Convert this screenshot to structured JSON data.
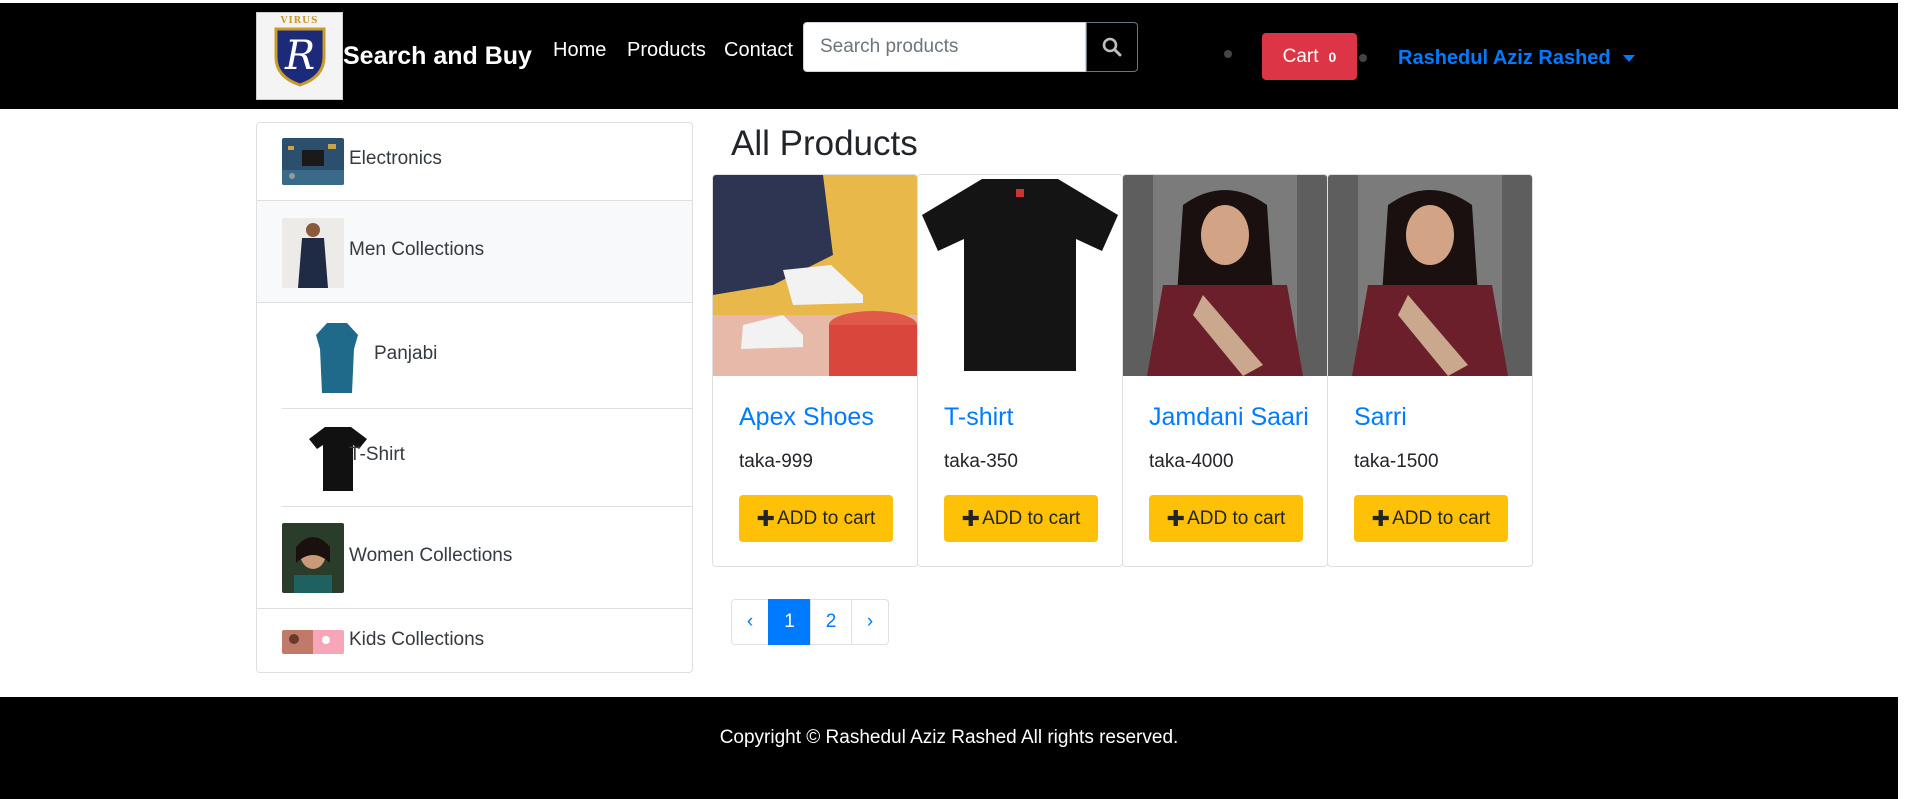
{
  "brand": {
    "logo_caption": "VIRUS",
    "logo_letter": "R",
    "name": "Search and Buy"
  },
  "nav": {
    "items": [
      {
        "label": "Home"
      },
      {
        "label": "Products"
      },
      {
        "label": "Contact"
      }
    ]
  },
  "search": {
    "placeholder": "Search products",
    "value": ""
  },
  "cart": {
    "label": "Cart",
    "count": "0"
  },
  "user": {
    "name": "Rashedul Aziz Rashed"
  },
  "sidebar": {
    "categories": [
      {
        "label": "Electronics"
      },
      {
        "label": "Men Collections"
      },
      {
        "label": "Panjabi"
      },
      {
        "label": "T-Shirt"
      },
      {
        "label": "Women Collections"
      },
      {
        "label": "Kids Collections"
      }
    ]
  },
  "main": {
    "title": "All Products"
  },
  "products": [
    {
      "name": "Apex Shoes",
      "price": "taka-999",
      "button": "ADD to cart"
    },
    {
      "name": "T-shirt",
      "price": "taka-350",
      "button": "ADD to cart"
    },
    {
      "name": "Jamdani Saari",
      "price": "taka-4000",
      "button": "ADD to cart"
    },
    {
      "name": "Sarri",
      "price": "taka-1500",
      "button": "ADD to cart"
    }
  ],
  "pagination": {
    "prev": "‹",
    "pages": [
      "1",
      "2"
    ],
    "active": "1",
    "next": "›"
  },
  "footer": {
    "text": "Copyright © Rashedul Aziz Rashed All rights reserved."
  },
  "colors": {
    "navbar": "#000000",
    "cart": "#dc3545",
    "link": "#007bff",
    "add_button": "#ffc107"
  },
  "icons": {
    "search": "search-icon",
    "plus": "plus-icon",
    "user_caret": "chevron-down-icon"
  }
}
